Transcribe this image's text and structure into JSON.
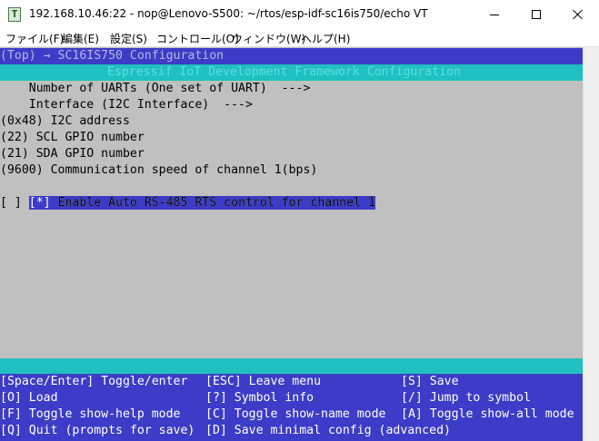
{
  "window": {
    "title": "192.168.10.46:22 - nop@Lenovo-S500: ~/rtos/esp-idf-sc16is750/echo VT",
    "app_icon_glyph": "T",
    "icons": {
      "app": "teraterm-icon",
      "minimize": "minimize-icon",
      "maximize": "maximize-icon",
      "close": "close-icon"
    }
  },
  "menubar": {
    "items": [
      {
        "label": "ファイル(F)"
      },
      {
        "label": "編集(E)"
      },
      {
        "label": "設定(S)"
      },
      {
        "label": "コントロール(O)"
      },
      {
        "label": "ウィンドウ(W)"
      },
      {
        "label": "ヘルプ(H)"
      }
    ]
  },
  "terminal": {
    "breadcrumb": "(Top) → SC16IS750 Configuration",
    "banner": "Espressif IoT Development Framework Configuration",
    "lines": [
      "    Number of UARTs (One set of UART)  --->",
      "    Interface (I2C Interface)  --->",
      "(0x48) I2C address",
      "(22) SCL GPIO number",
      "(21) SDA GPIO number",
      "(9600) Communication speed of channel 1(bps)"
    ],
    "selected_line": "[*] Enable Auto RS-485 RTS control for channel 1",
    "unselected_line": "[ ]     Enable Auto RS-485 RTS control for channel 1",
    "footer": [
      [
        "[Space/Enter] Toggle/enter",
        "[ESC] Leave menu",
        "[S] Save"
      ],
      [
        "[O] Load",
        "[?] Symbol info",
        "[/] Jump to symbol"
      ],
      [
        "[F] Toggle show-help mode",
        "[C] Toggle show-name mode",
        "[A] Toggle show-all mode"
      ],
      [
        "[Q] Quit (prompts for save)",
        "[D] Save minimal config (advanced)",
        ""
      ]
    ]
  },
  "colors": {
    "terminal_bg": "#c0c0c0",
    "blue_band": "#3c3cc8",
    "cyan_band": "#20c0c0"
  }
}
